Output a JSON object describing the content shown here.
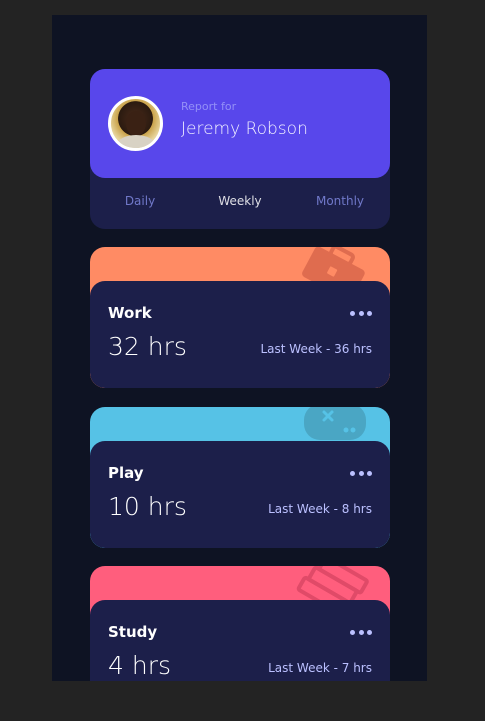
{
  "profile": {
    "report_for": "Report for",
    "name": "Jeremy Robson"
  },
  "tabs": [
    {
      "label": "Daily",
      "active": false
    },
    {
      "label": "Weekly",
      "active": true
    },
    {
      "label": "Monthly",
      "active": false
    }
  ],
  "cards": [
    {
      "title": "Work",
      "hours": "32 hrs",
      "last_week": "Last Week - 36 hrs",
      "color": "#ff8b64",
      "icon": "briefcase-icon"
    },
    {
      "title": "Play",
      "hours": "10 hrs",
      "last_week": "Last Week - 8 hrs",
      "color": "#56c2e6",
      "icon": "gamepad-icon"
    },
    {
      "title": "Study",
      "hours": "4 hrs",
      "last_week": "Last Week - 7 hrs",
      "color": "#ff5e7d",
      "icon": "books-icon"
    }
  ],
  "colors": {
    "page_bg": "#232323",
    "app_bg": "#0e1323",
    "card_bg": "#1c1f4a",
    "profile_bg": "#5847eb",
    "muted_text": "#bbc0ff",
    "tab_text": "#7078c9"
  }
}
